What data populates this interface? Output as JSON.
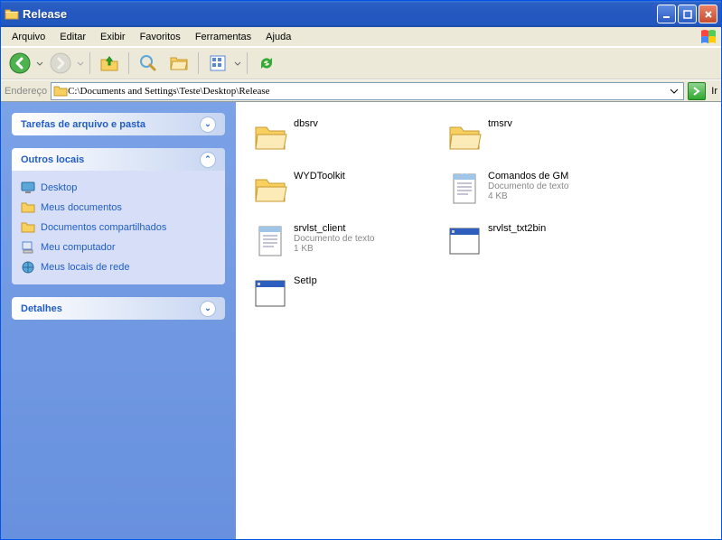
{
  "window": {
    "title": "Release"
  },
  "menubar": [
    "Arquivo",
    "Editar",
    "Exibir",
    "Favoritos",
    "Ferramentas",
    "Ajuda"
  ],
  "address": {
    "label": "Endereço",
    "value": "C:\\Documents and Settings\\Teste\\Desktop\\Release",
    "go": "Ir"
  },
  "sidebar": {
    "tasks": {
      "title": "Tarefas de arquivo e pasta"
    },
    "other": {
      "title": "Outros locais",
      "items": [
        "Desktop",
        "Meus documentos",
        "Documentos compartilhados",
        "Meu computador",
        "Meus locais de rede"
      ]
    },
    "details": {
      "title": "Detalhes"
    }
  },
  "files": [
    {
      "name": "dbsrv",
      "type": "folder"
    },
    {
      "name": "tmsrv",
      "type": "folder"
    },
    {
      "name": "WYDToolkit",
      "type": "folder"
    },
    {
      "name": "Comandos de GM",
      "type": "text",
      "meta1": "Documento de texto",
      "meta2": "4 KB"
    },
    {
      "name": "srvlst_client",
      "type": "text",
      "meta1": "Documento de texto",
      "meta2": "1 KB"
    },
    {
      "name": "srvlst_txt2bin",
      "type": "app"
    },
    {
      "name": "SetIp",
      "type": "app"
    }
  ]
}
